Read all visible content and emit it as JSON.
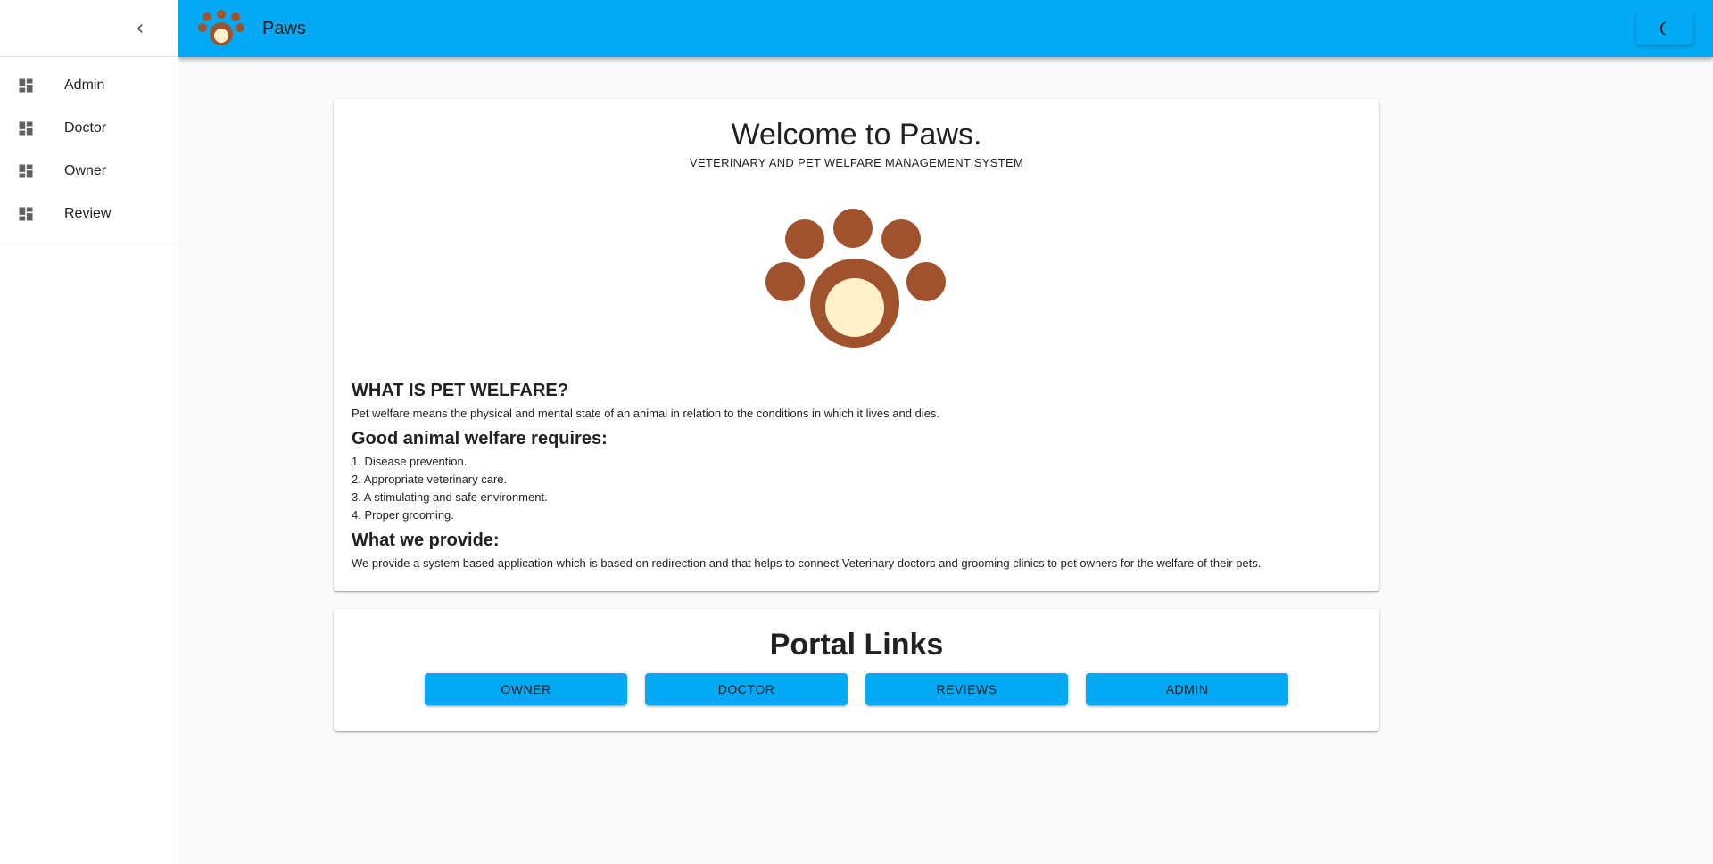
{
  "app": {
    "title": "Paws",
    "brand_color": "#03a9f4",
    "paw_brown": "#a0522d",
    "paw_cream": "#fff1c9"
  },
  "sidebar": {
    "collapse_icon": "chevron-left-icon",
    "items": [
      {
        "label": "Admin",
        "icon": "dashboard-icon"
      },
      {
        "label": "Doctor",
        "icon": "dashboard-icon"
      },
      {
        "label": "Owner",
        "icon": "dashboard-icon"
      },
      {
        "label": "Review",
        "icon": "dashboard-icon"
      }
    ]
  },
  "appbar": {
    "title": "Paws",
    "logo_icon": "paw-icon",
    "theme_toggle_icon": "moon-icon"
  },
  "welcome": {
    "title": "Welcome to Paws.",
    "subtitle": "VETERINARY AND PET WELFARE MANAGEMENT SYSTEM",
    "what_heading": "WHAT IS PET WELFARE?",
    "what_text": "Pet welfare means the physical and mental state of an animal in relation to the conditions in which it lives and dies.",
    "requires_heading": "Good animal welfare requires:",
    "requirements": [
      "1. Disease prevention.",
      "2. Appropriate veterinary care.",
      "3. A stimulating and safe environment.",
      "4. Proper grooming."
    ],
    "provide_heading": "What we provide:",
    "provide_text": "We provide a system based application which is based on redirection and that helps to connect Veterinary doctors and grooming clinics to pet owners for the welfare of their pets."
  },
  "portal": {
    "title": "Portal Links",
    "buttons": [
      "OWNER",
      "DOCTOR",
      "REVIEWS",
      "ADMIN"
    ]
  }
}
